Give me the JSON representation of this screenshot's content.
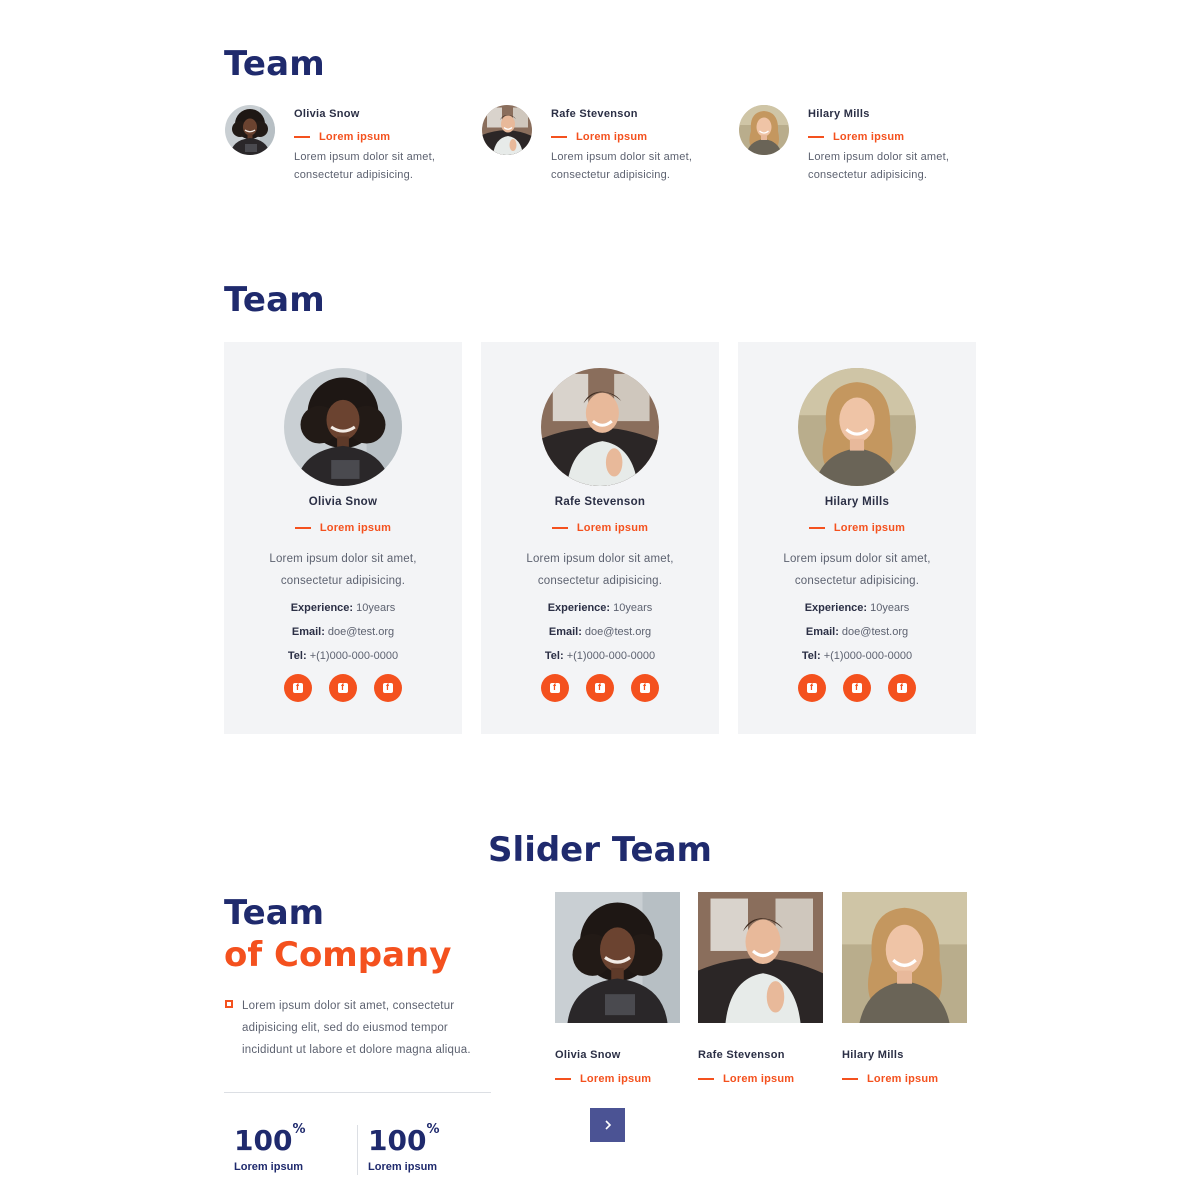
{
  "section1": {
    "title": "Team",
    "members": [
      {
        "name": "Olivia Snow",
        "role": "Lorem ipsum",
        "desc1": "Lorem ipsum dolor sit amet,",
        "desc2": "consectetur adipisicing."
      },
      {
        "name": "Rafe Stevenson",
        "role": "Lorem ipsum",
        "desc1": "Lorem ipsum dolor sit amet,",
        "desc2": "consectetur adipisicing."
      },
      {
        "name": "Hilary Mills",
        "role": "Lorem ipsum",
        "desc1": "Lorem ipsum dolor sit amet,",
        "desc2": "consectetur adipisicing."
      }
    ]
  },
  "section2": {
    "title": "Team",
    "labels": {
      "experience": "Experience:",
      "email": "Email:",
      "tel": "Tel:"
    },
    "members": [
      {
        "name": "Olivia Snow",
        "role": "Lorem ipsum",
        "desc1": "Lorem ipsum dolor sit amet,",
        "desc2": "consectetur adipisicing.",
        "experience": " 10years",
        "email": " doe@test.org",
        "tel": " +(1)000-000-0000"
      },
      {
        "name": "Rafe Stevenson",
        "role": "Lorem ipsum",
        "desc1": "Lorem ipsum dolor sit amet,",
        "desc2": "consectetur adipisicing.",
        "experience": " 10years",
        "email": " doe@test.org",
        "tel": " +(1)000-000-0000"
      },
      {
        "name": "Hilary Mills",
        "role": "Lorem ipsum",
        "desc1": "Lorem ipsum dolor sit amet,",
        "desc2": "consectetur adipisicing.",
        "experience": " 10years",
        "email": " doe@test.org",
        "tel": " +(1)000-000-0000"
      }
    ],
    "social_icon": "facebook-icon"
  },
  "section3": {
    "title": "Slider Team",
    "heading_line1": "Team",
    "heading_line2": "of Company",
    "bullet_text1": "Lorem ipsum dolor sit amet, consectetur",
    "bullet_text2": "adipisicing elit, sed do eiusmod tempor",
    "bullet_text3": "incididunt ut labore et dolore magna aliqua.",
    "stats": [
      {
        "value": "100",
        "suffix": "%",
        "label": "Lorem ipsum"
      },
      {
        "value": "100",
        "suffix": "%",
        "label": "Lorem ipsum"
      }
    ],
    "slides": [
      {
        "name": "Olivia Snow",
        "role": "Lorem ipsum"
      },
      {
        "name": "Rafe Stevenson",
        "role": "Lorem ipsum"
      },
      {
        "name": "Hilary Mills",
        "role": "Lorem ipsum"
      }
    ],
    "next_icon": "chevron-right-icon"
  },
  "colors": {
    "navy": "#1f2a6d",
    "accent": "#f4511e",
    "card_bg": "#f3f4f6",
    "slider_button": "#4b5394"
  }
}
